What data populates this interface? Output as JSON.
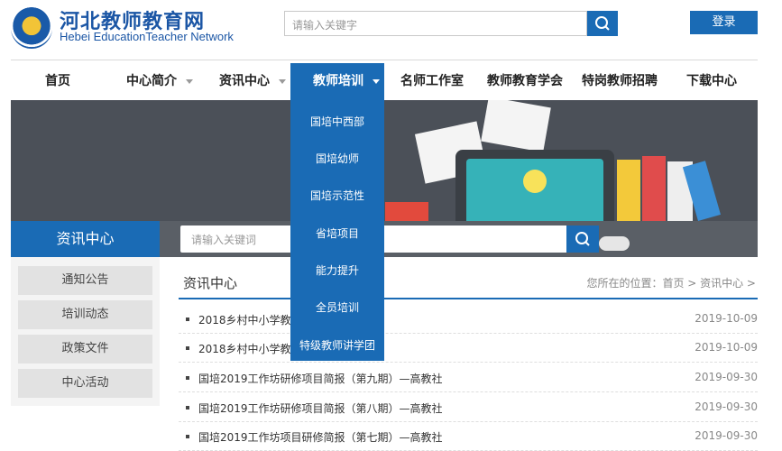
{
  "header": {
    "logo_cn": "河北教师教育网",
    "logo_en": "Hebei EducationTeacher Network",
    "search_placeholder": "请输入关键字",
    "login_label": "登录"
  },
  "nav": {
    "items": [
      "首页",
      "中心简介",
      "资讯中心",
      "教师培训",
      "名师工作室",
      "教师教育学会",
      "特岗教师招聘",
      "下载中心"
    ],
    "active_index": 3
  },
  "dropdown": {
    "items": [
      "国培中西部",
      "国培幼师",
      "国培示范性",
      "省培项目",
      "能力提升",
      "全员培训",
      "特级教师讲学团"
    ]
  },
  "banner": {
    "search_placeholder": "请输入关键词"
  },
  "sidebar": {
    "title": "资讯中心",
    "items": [
      "通知公告",
      "培训动态",
      "政策文件",
      "中心活动"
    ]
  },
  "content": {
    "title": "资讯中心",
    "breadcrumb": "您所在的位置：首页 > 资讯中心 >",
    "news": [
      {
        "title": "2018乡村中小学教师...简报5 - 浙师大",
        "date": "2019-10-09"
      },
      {
        "title": "2018乡村中小学教师...简报4 - 浙师大",
        "date": "2019-10-09"
      },
      {
        "title": "国培2019工作坊研修项目简报（第九期）—高教社",
        "date": "2019-09-30"
      },
      {
        "title": "国培2019工作坊研修项目简报（第八期）—高教社",
        "date": "2019-09-30"
      },
      {
        "title": "国培2019工作坊项目研修简报（第七期）—高教社",
        "date": "2019-09-30"
      }
    ]
  },
  "colors": {
    "accent": "#1a6bb5",
    "banner": "#4b5058"
  }
}
